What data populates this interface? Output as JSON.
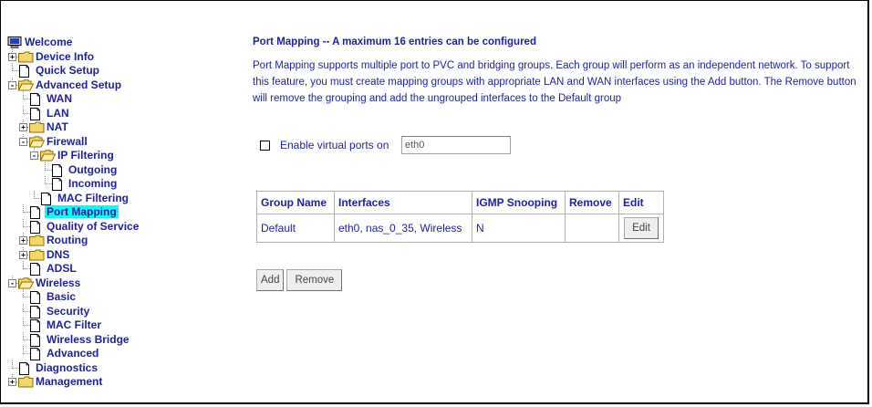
{
  "tree": {
    "items": [
      {
        "label": "Welcome",
        "level": 0,
        "type": "computer"
      },
      {
        "label": "Device Info",
        "level": 1,
        "type": "folder",
        "expander": "+"
      },
      {
        "label": "Quick Setup",
        "level": 1,
        "type": "page"
      },
      {
        "label": "Advanced Setup",
        "level": 1,
        "type": "folder-open",
        "expander": "-"
      },
      {
        "label": "WAN",
        "level": 2,
        "type": "page"
      },
      {
        "label": "LAN",
        "level": 2,
        "type": "page"
      },
      {
        "label": "NAT",
        "level": 2,
        "type": "folder",
        "expander": "+"
      },
      {
        "label": "Firewall",
        "level": 2,
        "type": "folder-open",
        "expander": "-"
      },
      {
        "label": "IP Filtering",
        "level": 3,
        "type": "folder-open",
        "expander": "-"
      },
      {
        "label": "Outgoing",
        "level": 4,
        "type": "page"
      },
      {
        "label": "Incoming",
        "level": 4,
        "type": "page"
      },
      {
        "label": "MAC Filtering",
        "level": 3,
        "type": "page"
      },
      {
        "label": "Port Mapping",
        "level": 2,
        "type": "page",
        "selected": true
      },
      {
        "label": "Quality of Service",
        "level": 2,
        "type": "page"
      },
      {
        "label": "Routing",
        "level": 2,
        "type": "folder",
        "expander": "+"
      },
      {
        "label": "DNS",
        "level": 2,
        "type": "folder",
        "expander": "+"
      },
      {
        "label": "ADSL",
        "level": 2,
        "type": "page"
      },
      {
        "label": "Wireless",
        "level": 1,
        "type": "folder-open",
        "expander": "-"
      },
      {
        "label": "Basic",
        "level": 2,
        "type": "page"
      },
      {
        "label": "Security",
        "level": 2,
        "type": "page"
      },
      {
        "label": "MAC Filter",
        "level": 2,
        "type": "page"
      },
      {
        "label": "Wireless Bridge",
        "level": 2,
        "type": "page"
      },
      {
        "label": "Advanced",
        "level": 2,
        "type": "page"
      },
      {
        "label": "Diagnostics",
        "level": 1,
        "type": "page"
      },
      {
        "label": "Management",
        "level": 1,
        "type": "folder",
        "expander": "+"
      }
    ]
  },
  "main": {
    "title": "Port Mapping -- A maximum 16 entries can be configured",
    "description": "Port Mapping supports multiple port to PVC and bridging groups. Each group will perform as an independent network. To support this feature, you must create mapping groups with appropriate LAN and WAN interfaces using the Add button. The Remove button will remove the grouping and add the ungrouped interfaces to the Default group",
    "virtual_ports": {
      "label": "Enable virtual ports on",
      "value": "eth0",
      "checked": false
    },
    "table": {
      "headers": [
        "Group Name",
        "Interfaces",
        "IGMP Snooping",
        "Remove",
        "Edit"
      ],
      "rows": [
        {
          "group_name": "Default",
          "interfaces": "eth0, nas_0_35, Wireless",
          "igmp": "N",
          "remove": "",
          "edit": "Edit"
        }
      ]
    },
    "buttons": {
      "add": "Add",
      "remove": "Remove"
    }
  },
  "colors": {
    "text": "#1f1fa0",
    "selected_bg": "#00ffff",
    "folder": "#f5d76e"
  }
}
